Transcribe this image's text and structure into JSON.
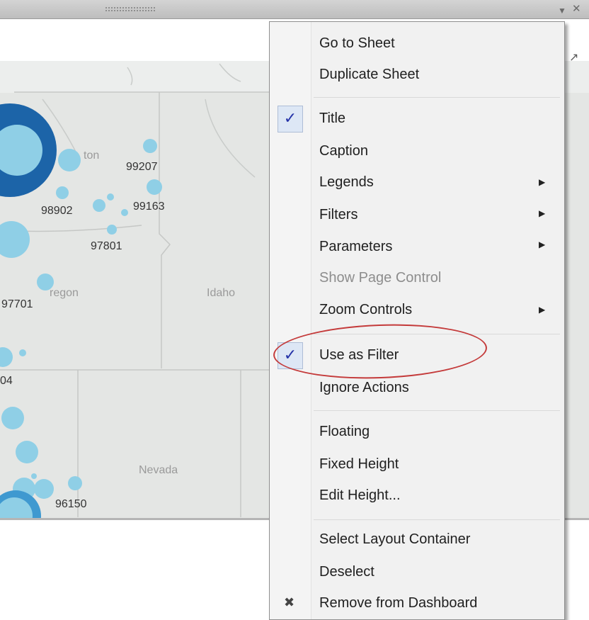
{
  "frame": {
    "grip_icon": "drag-grip",
    "menu_arrow_icon": "dropdown-arrow",
    "close_icon": "close-x",
    "external_icon": "open-external"
  },
  "map": {
    "states": [
      "Oregon",
      "Idaho",
      "Nevada"
    ],
    "state_labels": {
      "oregon": "regon",
      "idaho": "Idaho",
      "nevada": "Nevada",
      "washington": "ton"
    },
    "zip_labels": [
      "99207",
      "98902",
      "99163",
      "97801",
      "97701",
      "04",
      "96150"
    ],
    "colors": {
      "bubble_light": "#8fcfe6",
      "bubble_dark": "#1c64a8",
      "background": "#e8e9e7"
    }
  },
  "menu": {
    "items": {
      "go_to_sheet": "Go to Sheet",
      "duplicate_sheet": "Duplicate Sheet",
      "title": "Title",
      "caption": "Caption",
      "legends": "Legends",
      "filters": "Filters",
      "parameters": "Parameters",
      "show_page_control": "Show Page Control",
      "zoom_controls": "Zoom Controls",
      "use_as_filter": "Use as Filter",
      "ignore_actions": "Ignore Actions",
      "floating": "Floating",
      "fixed_height": "Fixed Height",
      "edit_height": "Edit Height...",
      "select_layout_container": "Select Layout Container",
      "deselect": "Deselect",
      "remove_from_dashboard": "Remove from Dashboard"
    },
    "checked": {
      "title": true,
      "use_as_filter": true
    },
    "disabled": {
      "show_page_control": true
    },
    "check_glyph": "✓",
    "submenu_glyph": "▶",
    "remove_glyph": "✖",
    "highlight_color": "#c43a3a"
  }
}
